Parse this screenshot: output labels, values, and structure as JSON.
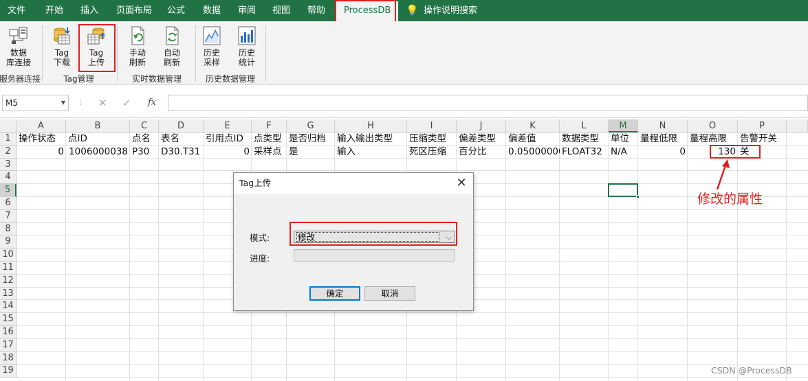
{
  "menu": {
    "items": [
      "文件",
      "开始",
      "插入",
      "页面布局",
      "公式",
      "数据",
      "审阅",
      "视图",
      "帮助"
    ],
    "active_tab": "ProcessDB",
    "search_label": "操作说明搜索",
    "colors": {
      "bar": "#217346",
      "highlight": "#e02020"
    }
  },
  "ribbon": {
    "buttons": {
      "db_connect": "数据\n库连接",
      "tag_download": "Tag\n下载",
      "tag_upload": "Tag\n上传",
      "manual_refresh": "手动\n刷新",
      "auto_refresh": "自动\n刷新",
      "history_sample": "历史\n采样",
      "history_stats": "历史\n统计"
    },
    "groups": {
      "server": "服务器连接",
      "tag": "Tag管理",
      "realtime": "实时数据管理",
      "history": "历史数据管理"
    }
  },
  "formula_bar": {
    "name_box": "M5",
    "fx": "fx",
    "value": ""
  },
  "sheet": {
    "columns": [
      "A",
      "B",
      "C",
      "D",
      "E",
      "F",
      "G",
      "H",
      "I",
      "J",
      "K",
      "L",
      "M",
      "N",
      "O",
      "P"
    ],
    "selected_column": "M",
    "rows": [
      "1",
      "2",
      "3",
      "4",
      "5",
      "6",
      "7",
      "8",
      "9",
      "10",
      "11",
      "12",
      "13",
      "14",
      "15",
      "16",
      "17",
      "18",
      "19"
    ],
    "selected_row": "5",
    "selected_cell": "M5",
    "header_row": [
      "操作状态",
      "点ID",
      "点名",
      "表名",
      "引用点ID",
      "点类型",
      "是否归档",
      "输入输出类型",
      "压缩类型",
      "偏差类型",
      "偏差值",
      "数据类型",
      "单位",
      "量程低限",
      "量程高限",
      "告警开关"
    ],
    "data_row": [
      "0",
      "1006000038",
      "P30",
      "D30.T31",
      "0",
      "采样点",
      "是",
      "输入",
      "死区压缩",
      "百分比",
      "0.050000001",
      "FLOAT32",
      "N/A",
      "0",
      "130",
      "关"
    ]
  },
  "dialog": {
    "title": "Tag上传",
    "close_glyph": "✕",
    "mode_label": "模式:",
    "mode_value": "修改",
    "progress_label": "进度:",
    "progress": 0,
    "ok_label": "确定",
    "cancel_label": "取消"
  },
  "annotation": "修改的属性",
  "watermark": "CSDN @ProcessDB"
}
